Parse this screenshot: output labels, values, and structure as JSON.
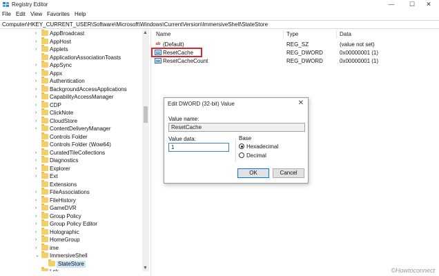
{
  "window": {
    "title": "Registry Editor",
    "minimize": "—",
    "maximize": "☐",
    "close": "✕"
  },
  "menu": [
    "File",
    "Edit",
    "View",
    "Favorites",
    "Help"
  ],
  "address": "Computer\\HKEY_CURRENT_USER\\Software\\Microsoft\\Windows\\CurrentVersion\\ImmersiveShell\\StateStore",
  "tree": {
    "items": [
      {
        "label": "AppBroadcast",
        "expander": "›"
      },
      {
        "label": "AppHost",
        "expander": "›"
      },
      {
        "label": "Applets",
        "expander": "›"
      },
      {
        "label": "ApplicationAssociationToasts",
        "expander": ""
      },
      {
        "label": "AppSync",
        "expander": "›"
      },
      {
        "label": "Appx",
        "expander": "›"
      },
      {
        "label": "Authentication",
        "expander": "›"
      },
      {
        "label": "BackgroundAccessApplications",
        "expander": "›"
      },
      {
        "label": "CapabilityAccessManager",
        "expander": "›"
      },
      {
        "label": "CDP",
        "expander": "›"
      },
      {
        "label": "ClickNote",
        "expander": "›"
      },
      {
        "label": "CloudStore",
        "expander": "›"
      },
      {
        "label": "ContentDeliveryManager",
        "expander": "›"
      },
      {
        "label": "Controls Folder",
        "expander": ""
      },
      {
        "label": "Controls Folder (Wow64)",
        "expander": ""
      },
      {
        "label": "CuratedTileCollections",
        "expander": "›"
      },
      {
        "label": "Diagnostics",
        "expander": "›"
      },
      {
        "label": "Explorer",
        "expander": "›"
      },
      {
        "label": "Ext",
        "expander": "›"
      },
      {
        "label": "Extensions",
        "expander": ""
      },
      {
        "label": "FileAssociations",
        "expander": "›"
      },
      {
        "label": "FileHistory",
        "expander": "›"
      },
      {
        "label": "GameDVR",
        "expander": "›"
      },
      {
        "label": "Group Policy",
        "expander": "›"
      },
      {
        "label": "Group Policy Editor",
        "expander": "›"
      },
      {
        "label": "Holographic",
        "expander": "›"
      },
      {
        "label": "HomeGroup",
        "expander": "›"
      },
      {
        "label": "ime",
        "expander": "›"
      },
      {
        "label": "ImmersiveShell",
        "expander": "⌄"
      }
    ],
    "selected": "StateStore",
    "partial": "Lnk..."
  },
  "list": {
    "headers": {
      "name": "Name",
      "type": "Type",
      "data": "Data"
    },
    "rows": [
      {
        "icon": "ab",
        "name": "(Default)",
        "type": "REG_SZ",
        "data": "(value not set)"
      },
      {
        "icon": "",
        "name": "ResetCache",
        "type": "REG_DWORD",
        "data": "0x00000001 (1)"
      },
      {
        "icon": "",
        "name": "ResetCacheCount",
        "type": "REG_DWORD",
        "data": "0x00000001 (1)"
      }
    ]
  },
  "dialog": {
    "title": "Edit DWORD (32-bit) Value",
    "close": "✕",
    "value_name_label": "Value name:",
    "value_name": "ResetCache",
    "value_data_label": "Value data:",
    "value_data": "1",
    "base_label": "Base",
    "base_options": [
      {
        "label": "Hexadecimal",
        "selected": true
      },
      {
        "label": "Decimal",
        "selected": false
      }
    ],
    "ok": "OK",
    "cancel": "Cancel"
  },
  "watermark": "©Howtoconnect",
  "colors": {
    "highlight": "#e0242a",
    "selection": "#cce4f7",
    "folder": "#f3cf6a"
  }
}
